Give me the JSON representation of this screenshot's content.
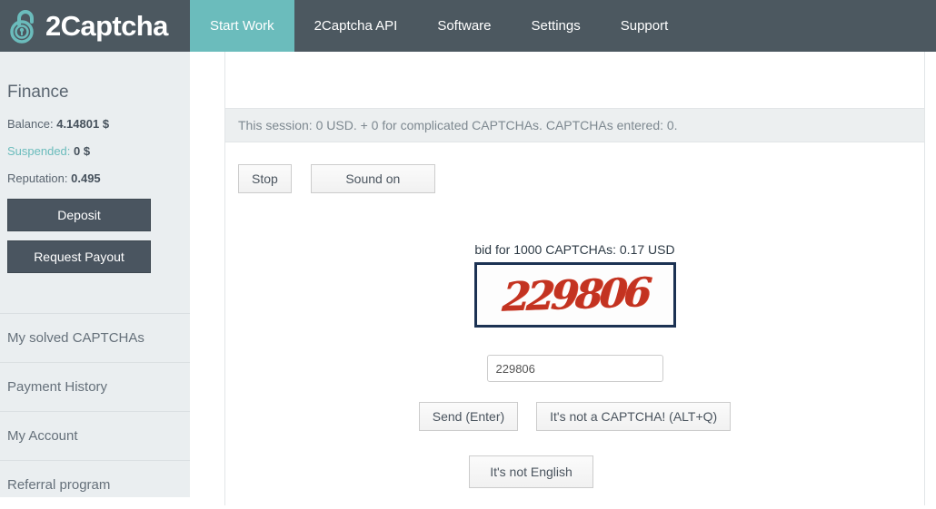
{
  "header": {
    "logo_icon": "open-padlock-icon",
    "logo_text": "2Captcha",
    "nav": [
      {
        "label": "Start Work",
        "active": true
      },
      {
        "label": "2Captcha API",
        "active": false
      },
      {
        "label": "Software",
        "active": false
      },
      {
        "label": "Settings",
        "active": false
      },
      {
        "label": "Support",
        "active": false
      }
    ]
  },
  "sidebar": {
    "finance_title": "Finance",
    "balance_label": "Balance:",
    "balance_value": "4.14801 $",
    "suspended_label": "Suspended:",
    "suspended_value": "0 $",
    "reputation_label": "Reputation:",
    "reputation_value": "0.495",
    "deposit_label": "Deposit",
    "payout_label": "Request Payout",
    "menu": [
      {
        "label": "My solved CAPTCHAs"
      },
      {
        "label": "Payment History"
      },
      {
        "label": "My Account"
      },
      {
        "label": "Referral program"
      }
    ]
  },
  "main": {
    "session_status": "This session: 0 USD. + 0 for complicated CAPTCHAs. CAPTCHAs entered: 0.",
    "stop_label": "Stop",
    "sound_label": "Sound on",
    "bid_text": "bid for 1000 CAPTCHAs: 0.17 USD",
    "captcha_value": "229806",
    "answer_value": "229806",
    "answer_placeholder": "",
    "send_label": "Send (Enter)",
    "not_captcha_label": "It's not a CAPTCHA! (ALT+Q)",
    "not_english_label": "It's not English"
  },
  "colors": {
    "header_bg": "#4c5860",
    "accent_teal": "#6bbcbc",
    "sidebar_bg": "#eaeef0",
    "dark_button": "#4a5560",
    "captcha_red": "#c33321",
    "captcha_border": "#1c3253"
  }
}
